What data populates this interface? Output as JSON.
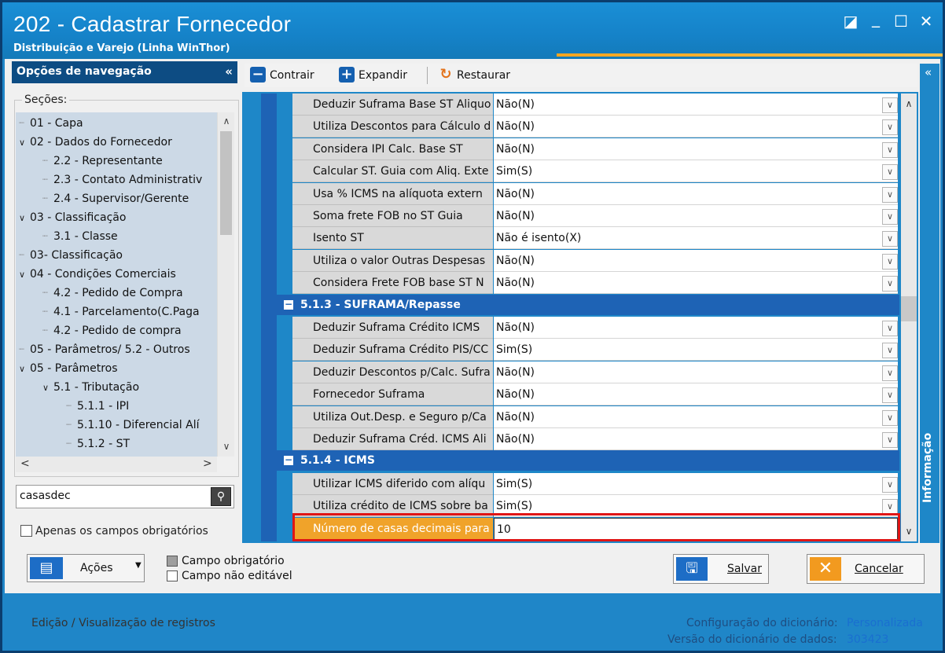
{
  "window": {
    "title": "202 - Cadastrar  Fornecedor",
    "subtitle": "Distribuição e Varejo (Linha WinThor)",
    "controls": {
      "restore": "◪",
      "minimize": "_",
      "maximize": "☐",
      "close": "✕"
    }
  },
  "nav": {
    "header": "Opções de navegação",
    "collapse": "«",
    "sections_label": "Seções:",
    "tree": [
      {
        "label": "01 - Capa",
        "level": 0,
        "expander": ""
      },
      {
        "label": "02 - Dados do Fornecedor",
        "level": 0,
        "expander": "∨"
      },
      {
        "label": "2.2 - Representante",
        "level": 1,
        "expander": ""
      },
      {
        "label": "2.3 - Contato Administrativ",
        "level": 1,
        "expander": ""
      },
      {
        "label": "2.4 - Supervisor/Gerente",
        "level": 1,
        "expander": ""
      },
      {
        "label": "03 - Classificação",
        "level": 0,
        "expander": "∨"
      },
      {
        "label": "3.1 - Classe",
        "level": 1,
        "expander": ""
      },
      {
        "label": "03- Classificação",
        "level": 0,
        "expander": ""
      },
      {
        "label": "04 - Condições Comerciais",
        "level": 0,
        "expander": "∨"
      },
      {
        "label": "4.2 - Pedido de Compra",
        "level": 1,
        "expander": ""
      },
      {
        "label": "4.1 - Parcelamento(C.Paga",
        "level": 1,
        "expander": ""
      },
      {
        "label": "4.2 - Pedido de compra",
        "level": 1,
        "expander": ""
      },
      {
        "label": "05 - Parâmetros/ 5.2 - Outros",
        "level": 0,
        "expander": ""
      },
      {
        "label": "05 - Parâmetros",
        "level": 0,
        "expander": "∨"
      },
      {
        "label": "5.1 - Tributação",
        "level": 1,
        "expander": "∨"
      },
      {
        "label": "5.1.1 - IPI",
        "level": 2,
        "expander": ""
      },
      {
        "label": "5.1.10 - Diferencial Alí",
        "level": 2,
        "expander": ""
      },
      {
        "label": "5.1.2 - ST",
        "level": 2,
        "expander": ""
      }
    ],
    "search_value": "casasdec",
    "only_required_label": "Apenas os campos obrigatórios"
  },
  "toolbar": {
    "contrair": "Contrair",
    "expandir": "Expandir",
    "restaurar": "Restaurar"
  },
  "grid": {
    "rows_top": [
      {
        "label": "Deduzir Suframa Base ST Aliquo",
        "value": "Não(N)"
      },
      {
        "label": "Utiliza Descontos para Cálculo d",
        "value": "Não(N)"
      },
      {
        "label": "Considera IPI Calc. Base ST",
        "value": "Não(N)"
      },
      {
        "label": "Calcular ST. Guia com Aliq. Exte",
        "value": "Sim(S)"
      },
      {
        "label": "Usa % ICMS na alíquota extern",
        "value": "Não(N)"
      },
      {
        "label": "Soma frete FOB no ST Guia",
        "value": "Não(N)"
      },
      {
        "label": "Isento ST",
        "value": "Não é isento(X)"
      },
      {
        "label": "Utiliza o valor Outras Despesas",
        "value": "Não(N)"
      },
      {
        "label": "Considera Frete FOB base ST N",
        "value": "Não(N)"
      }
    ],
    "section_suframa": "5.1.3 - SUFRAMA/Repasse",
    "rows_suframa": [
      {
        "label": "Deduzir Suframa Crédito ICMS",
        "value": "Não(N)"
      },
      {
        "label": "Deduzir Suframa Crédito PIS/CC",
        "value": "Sim(S)"
      },
      {
        "label": "Deduzir Descontos p/Calc. Sufra",
        "value": "Não(N)"
      },
      {
        "label": "Fornecedor Suframa",
        "value": "Não(N)"
      },
      {
        "label": "Utiliza Out.Desp. e Seguro p/Ca",
        "value": "Não(N)"
      },
      {
        "label": "Deduzir Suframa Créd. ICMS Ali",
        "value": "Não(N)"
      }
    ],
    "section_icms": "5.1.4 - ICMS",
    "rows_icms": [
      {
        "label": "Utilizar ICMS diferido com alíqu",
        "value": "Sim(S)"
      },
      {
        "label": "Utiliza crédito de ICMS sobre ba",
        "value": "Sim(S)"
      }
    ],
    "highlighted_row": {
      "label": "Número de casas decimais para",
      "value": "10"
    }
  },
  "info_panel": {
    "label": "Informação",
    "collapse": "«"
  },
  "actions": {
    "acoes": "Ações",
    "campo_obrigatorio": "Campo obrigatório",
    "campo_nao_editavel": "Campo não editável",
    "salvar": "Salvar",
    "cancelar": "Cancelar"
  },
  "footer": {
    "left": "Edição / Visualização de registros",
    "config_label": "Configuração do dicionário:",
    "config_value": "Personalizada",
    "version_label": "Versão do dicionário de dados:",
    "version_value": "303423"
  },
  "colors": {
    "title_blue": "#1a8fd6",
    "section_blue": "#1e63b5",
    "nav_header": "#0d4c83",
    "highlight_red": "#e01515",
    "cancel_orange": "#f29a1f"
  }
}
